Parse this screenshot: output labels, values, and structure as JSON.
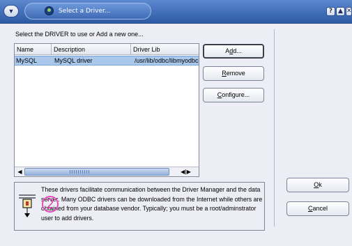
{
  "window": {
    "title": "Select a Driver...",
    "help_label": "?",
    "shade_label": "▲",
    "close_label": "✕",
    "menu_glyph": "▼"
  },
  "prompt": "Select the DRIVER to use or Add a new one...",
  "table": {
    "columns": [
      "Name",
      "Description",
      "Driver Lib"
    ],
    "rows": [
      [
        "MySQL",
        "MySQL driver",
        "/usr/lib/odbc/libmyodbc.so"
      ]
    ]
  },
  "scrollbar": {
    "left_arrow": "◀",
    "right_arrows": "◀ | ▶"
  },
  "buttons": {
    "add_prefix": "A",
    "add_underlined": "d",
    "add_suffix": "d...",
    "remove_underlined": "R",
    "remove_suffix": "emove",
    "configure_underlined": "C",
    "configure_suffix": "onfigure...",
    "ok_underlined": "O",
    "ok_suffix": "k",
    "cancel_underlined": "C",
    "cancel_suffix": "ancel"
  },
  "info": {
    "text": "These drivers facilitate communication between the Driver Manager and the data server. Many ODBC drivers can be downloaded from the Internet while others are obtained from your database vendor. Typically; you must be a root/adminstrator user to add drivers.",
    "icon": "plug-icon",
    "step_marker": "2"
  },
  "colors": {
    "titlebar": "#3f6cb6",
    "selection": "#a9c8ec",
    "step_marker": "#e34ab8"
  }
}
